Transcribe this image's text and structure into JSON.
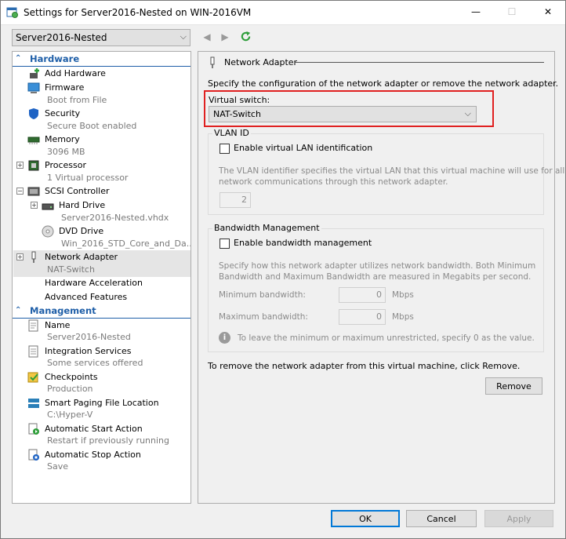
{
  "window": {
    "title": "Settings for Server2016-Nested on WIN-2016VM",
    "minimize": "—",
    "maximize": "☐",
    "close": "✕"
  },
  "toolbar": {
    "vm_select": "Server2016-Nested",
    "back_icon": "back-arrow-icon",
    "forward_icon": "forward-arrow-icon",
    "refresh_icon": "refresh-icon"
  },
  "tree": {
    "hardware_header": "Hardware",
    "management_header": "Management",
    "hardware": [
      {
        "label": "Add Hardware",
        "sub": ""
      },
      {
        "label": "Firmware",
        "sub": "Boot from File"
      },
      {
        "label": "Security",
        "sub": "Secure Boot enabled"
      },
      {
        "label": "Memory",
        "sub": "3096 MB"
      },
      {
        "label": "Processor",
        "sub": "1 Virtual processor"
      },
      {
        "label": "SCSI Controller",
        "sub": ""
      },
      {
        "label": "Hard Drive",
        "sub": "Server2016-Nested.vhdx"
      },
      {
        "label": "DVD Drive",
        "sub": "Win_2016_STD_Core_and_Da..."
      },
      {
        "label": "Network Adapter",
        "sub": "NAT-Switch"
      },
      {
        "label": "Hardware Acceleration",
        "sub": ""
      },
      {
        "label": "Advanced Features",
        "sub": ""
      }
    ],
    "management": [
      {
        "label": "Name",
        "sub": "Server2016-Nested"
      },
      {
        "label": "Integration Services",
        "sub": "Some services offered"
      },
      {
        "label": "Checkpoints",
        "sub": "Production"
      },
      {
        "label": "Smart Paging File Location",
        "sub": "C:\\Hyper-V"
      },
      {
        "label": "Automatic Start Action",
        "sub": "Restart if previously running"
      },
      {
        "label": "Automatic Stop Action",
        "sub": "Save"
      }
    ]
  },
  "network_adapter": {
    "section_title": "Network Adapter",
    "description": "Specify the configuration of the network adapter or remove the network adapter.",
    "virtual_switch_label": "Virtual switch:",
    "virtual_switch_value": "NAT-Switch",
    "highlight_color": "#e02020",
    "vlan": {
      "group_title": "VLAN ID",
      "checkbox_label": "Enable virtual LAN identification",
      "help_line1": "The VLAN identifier specifies the virtual LAN that this virtual machine will use for all",
      "help_line2": "network communications through this network adapter.",
      "value": "2"
    },
    "bandwidth": {
      "group_title": "Bandwidth Management",
      "checkbox_label": "Enable bandwidth management",
      "help_line1": "Specify how this network adapter utilizes network bandwidth. Both Minimum",
      "help_line2": "Bandwidth and Maximum Bandwidth are measured in Megabits per second.",
      "min_label": "Minimum bandwidth:",
      "min_value": "0",
      "max_label": "Maximum bandwidth:",
      "max_value": "0",
      "unit": "Mbps",
      "info": "To leave the minimum or maximum unrestricted, specify 0 as the value."
    },
    "remove_text": "To remove the network adapter from this virtual machine, click Remove.",
    "remove_button": "Remove"
  },
  "footer": {
    "ok": "OK",
    "cancel": "Cancel",
    "apply": "Apply"
  }
}
